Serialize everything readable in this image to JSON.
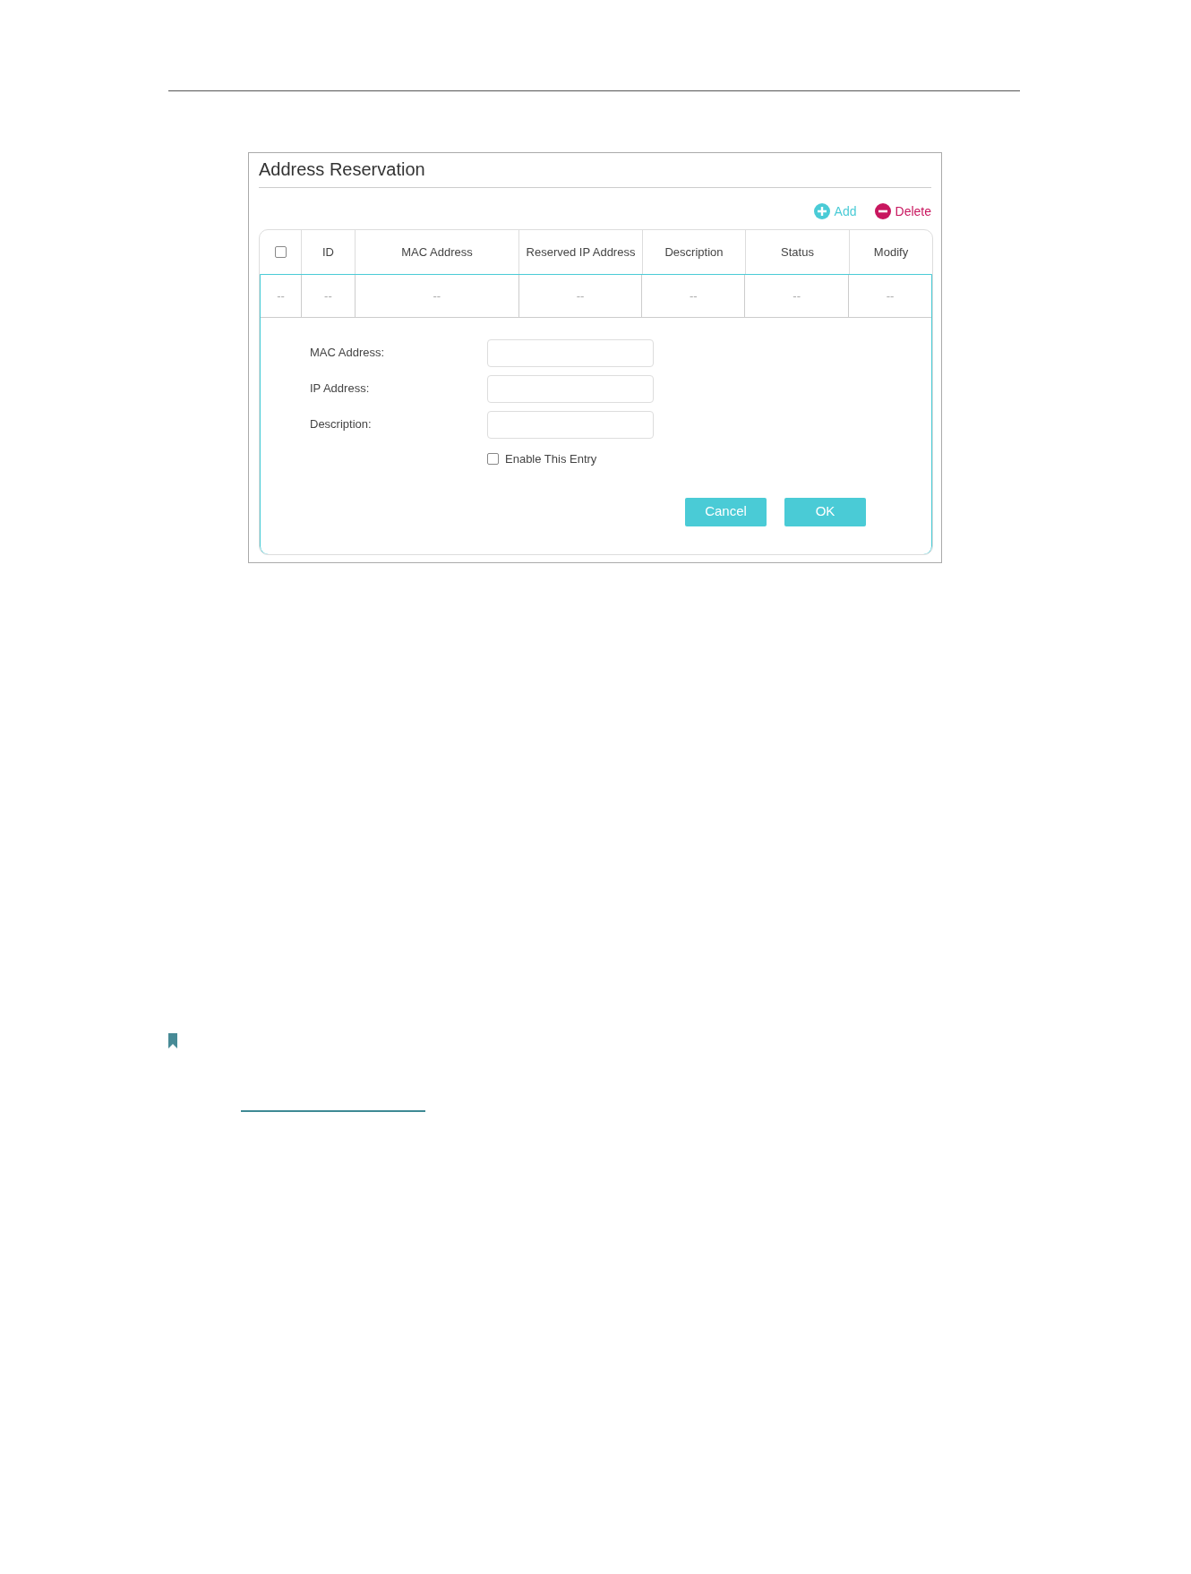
{
  "panel": {
    "title": "Address Reservation",
    "actions": [
      {
        "label": "Add",
        "kind": "add"
      },
      {
        "label": "Delete",
        "kind": "delete"
      }
    ],
    "table": {
      "columns": [
        {
          "kind": "checkbox",
          "checked": false
        },
        {
          "kind": "text",
          "label": "ID"
        },
        {
          "kind": "text",
          "label": "MAC Address"
        },
        {
          "kind": "text",
          "label": "Reserved IP Address"
        },
        {
          "kind": "text",
          "label": "Description"
        },
        {
          "kind": "text",
          "label": "Status"
        },
        {
          "kind": "text",
          "label": "Modify"
        }
      ],
      "rows": [
        {
          "cells": [
            "--",
            "--",
            "--",
            "--",
            "--",
            "--",
            "--"
          ]
        }
      ]
    },
    "form": {
      "fields": [
        {
          "label": "MAC Address:"
        },
        {
          "label": "IP Address:"
        },
        {
          "label": "Description:"
        }
      ],
      "enable": {
        "label": "Enable This Entry",
        "checked": false
      },
      "buttons": [
        {
          "label": "Cancel"
        },
        {
          "label": "OK"
        }
      ]
    }
  }
}
